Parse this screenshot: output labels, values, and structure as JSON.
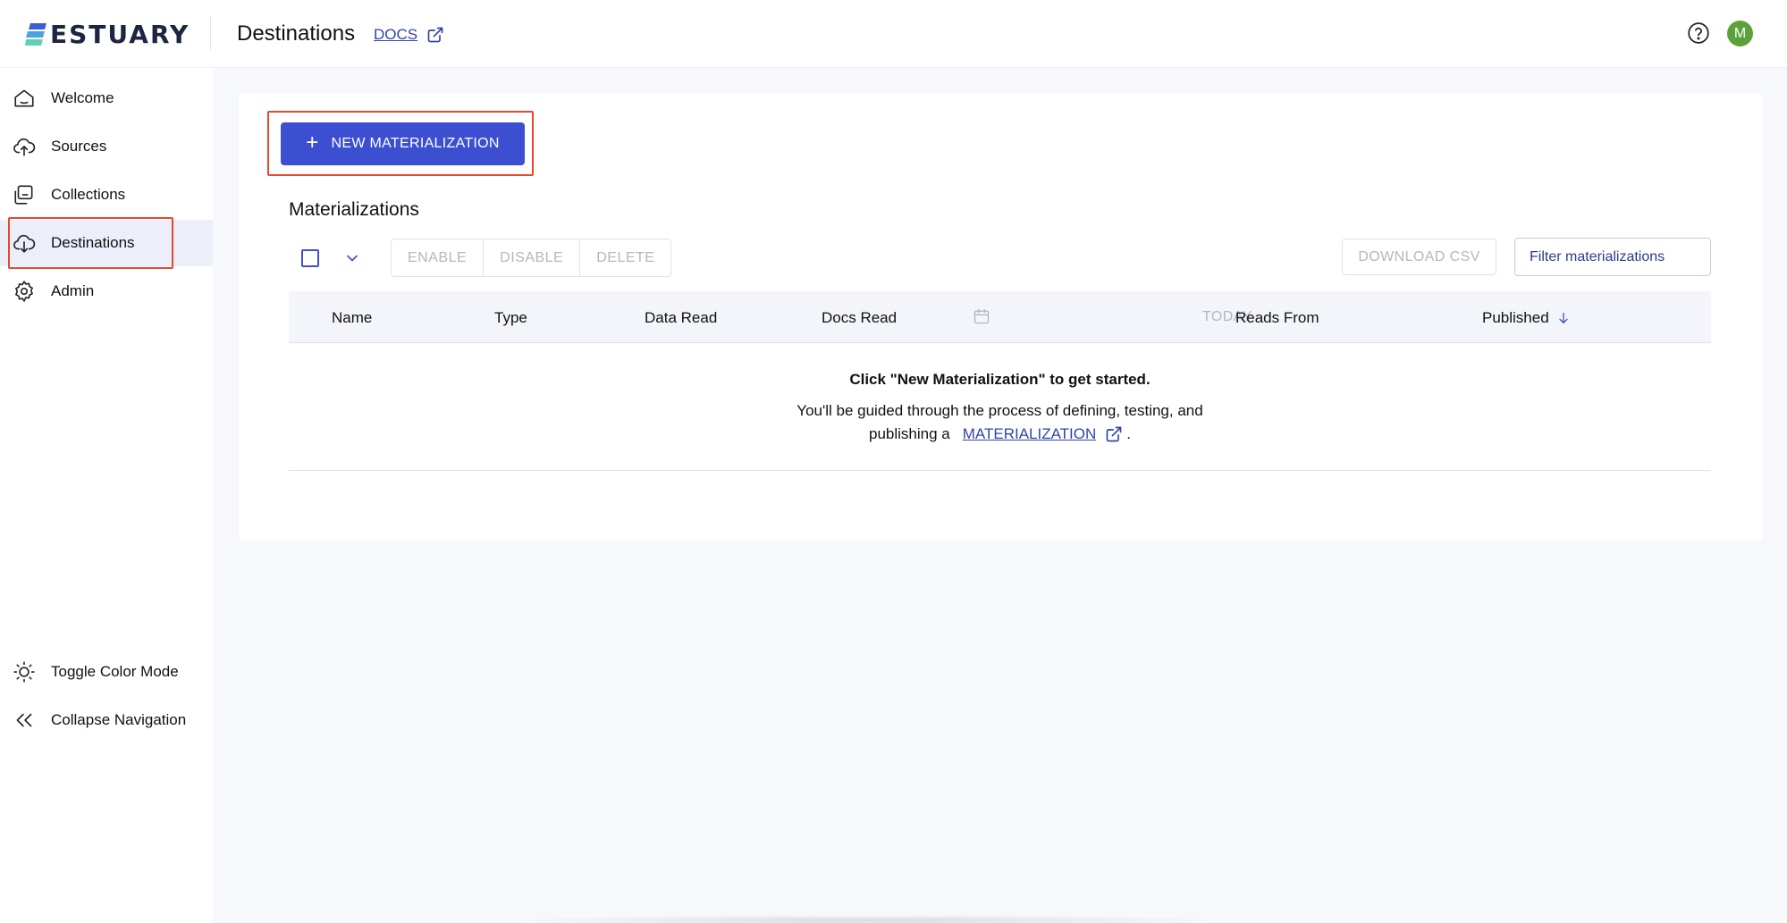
{
  "app": {
    "brand": "ESTUARY",
    "page_title": "Destinations",
    "docs_label": "DOCS",
    "avatar_initial": "M",
    "brand_colors": {
      "primary": "#3d4fd1",
      "link": "#3244a8",
      "avatar": "#5ca23a",
      "highlight": "#e34a2f"
    }
  },
  "sidebar": {
    "items": [
      {
        "label": "Welcome",
        "icon": "home-icon"
      },
      {
        "label": "Sources",
        "icon": "cloud-upload-icon"
      },
      {
        "label": "Collections",
        "icon": "collections-icon"
      },
      {
        "label": "Destinations",
        "icon": "cloud-download-icon",
        "active": true
      },
      {
        "label": "Admin",
        "icon": "gear-icon"
      }
    ],
    "toggle_color_mode": "Toggle Color Mode",
    "collapse_navigation": "Collapse Navigation"
  },
  "main": {
    "new_button": "NEW MATERIALIZATION",
    "section_title": "Materializations",
    "actions": {
      "enable": "ENABLE",
      "disable": "DISABLE",
      "delete": "DELETE"
    },
    "download_csv": "DOWNLOAD CSV",
    "filter_placeholder": "Filter materializations",
    "columns": {
      "name": "Name",
      "type": "Type",
      "data_read": "Data Read",
      "docs_read": "Docs Read",
      "today": "TODAY",
      "reads_from": "Reads From",
      "published": "Published"
    },
    "empty": {
      "title": "Click \"New Materialization\" to get started.",
      "line1": "You'll be guided through the process of defining, testing, and",
      "line2_prefix": "publishing a",
      "link": "MATERIALIZATION",
      "line2_suffix": "."
    }
  }
}
